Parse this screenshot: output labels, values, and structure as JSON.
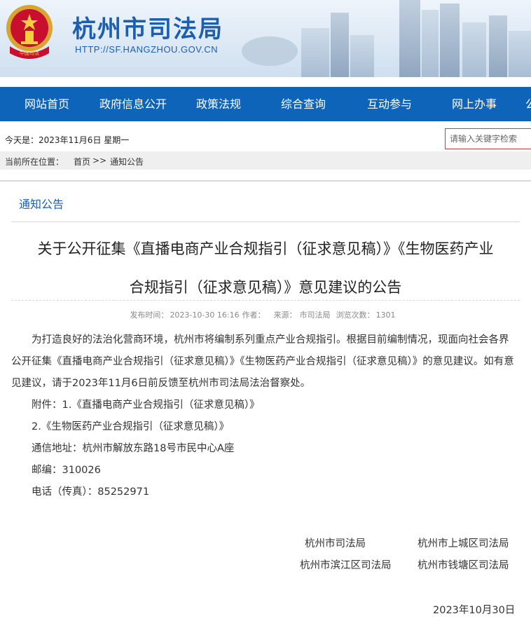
{
  "header": {
    "site_title": "杭州市司法局",
    "site_url": "HTTP://SF.HANGZHOU.GOV.CN",
    "emblem_text": "中国司法"
  },
  "nav": {
    "items": [
      {
        "label": "网站首页"
      },
      {
        "label": "政府信息公开"
      },
      {
        "label": "政策法规"
      },
      {
        "label": "综合查询"
      },
      {
        "label": "互动参与"
      },
      {
        "label": "网上办事"
      },
      {
        "label": "公"
      }
    ]
  },
  "today": "今天是：2023年11月6日  星期一",
  "search": {
    "placeholder": "请输入关键字检索"
  },
  "breadcrumb": {
    "prefix": "当前所在位置：",
    "home": "首页",
    "sep": ">>",
    "current": "通知公告"
  },
  "section_title": "通知公告",
  "article": {
    "title_line1": "关于公开征集《直播电商产业合规指引（征求意见稿）》《生物医药产业",
    "title_line2": "合规指引（征求意见稿）》意见建议的公告",
    "meta": {
      "publish_label": "发布时间：",
      "publish_time": "2023-10-30 16:16",
      "author_label": "作者：",
      "source_label": "来源：",
      "source": "市司法局",
      "views_label": "浏览次数：",
      "views": "1301"
    },
    "paragraph1": "为打造良好的法治化营商环境，杭州市将编制系列重点产业合规指引。根据目前编制情况，现面向社会各界公开征集《直播电商产业合规指引（征求意见稿）》《生物医药产业合规指引（征求意见稿）》的意见建议。如有意见建议，请于2023年11月6日前反馈至杭州市司法局法治督察处。",
    "attachment1": "附件：1.《直播电商产业合规指引（征求意见稿）》",
    "attachment2": "2.《生物医药产业合规指引（征求意见稿）》",
    "address": "通信地址：杭州市解放东路18号市民中心A座",
    "postcode": "邮编：310026",
    "phone": "电话（传真）：85252971",
    "signatures": [
      "杭州市司法局",
      "杭州市上城区司法局",
      "杭州市滨江区司法局",
      "杭州市钱塘区司法局"
    ],
    "date": "2023年10月30日"
  },
  "colors": {
    "brand_blue": "#0d64b8",
    "title_blue": "#1c5fae",
    "search_border": "#c43d3d"
  }
}
